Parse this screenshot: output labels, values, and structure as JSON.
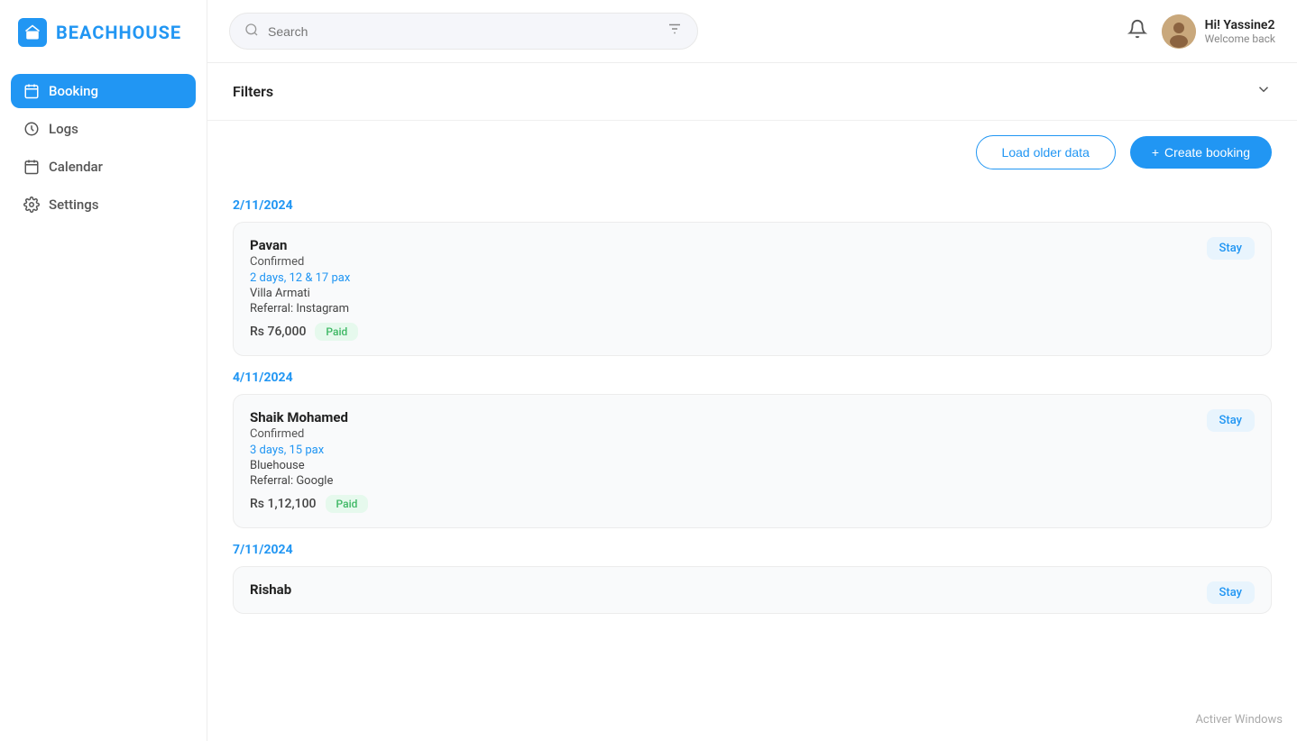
{
  "app": {
    "logo_text": "BEACHHOUSE",
    "logo_icon": "🏠"
  },
  "sidebar": {
    "items": [
      {
        "id": "booking",
        "label": "Booking",
        "icon": "📅",
        "active": true
      },
      {
        "id": "logs",
        "label": "Logs",
        "icon": "🕐",
        "active": false
      },
      {
        "id": "calendar",
        "label": "Calendar",
        "icon": "📆",
        "active": false
      },
      {
        "id": "settings",
        "label": "Settings",
        "icon": "⚙️",
        "active": false
      }
    ]
  },
  "topbar": {
    "search_placeholder": "Search",
    "user_name": "Hi! Yassine2",
    "user_welcome": "Welcome back"
  },
  "filters": {
    "title": "Filters"
  },
  "actions": {
    "load_older_label": "Load older data",
    "create_booking_label": "Create booking",
    "create_prefix": "+"
  },
  "bookings": [
    {
      "date": "2/11/2024",
      "entries": [
        {
          "name": "Pavan",
          "status": "Confirmed",
          "duration": "2 days, 12 & 17 pax",
          "venue": "Villa Armati",
          "referral": "Referral: Instagram",
          "amount": "Rs 76,000",
          "payment_status": "Paid",
          "type": "Stay"
        }
      ]
    },
    {
      "date": "4/11/2024",
      "entries": [
        {
          "name": "Shaik Mohamed",
          "status": "Confirmed",
          "duration": "3 days, 15 pax",
          "venue": "Bluehouse",
          "referral": "Referral: Google",
          "amount": "Rs 1,12,100",
          "payment_status": "Paid",
          "type": "Stay"
        }
      ]
    },
    {
      "date": "7/11/2024",
      "entries": [
        {
          "name": "Rishab",
          "status": "",
          "duration": "",
          "venue": "",
          "referral": "",
          "amount": "",
          "payment_status": "",
          "type": "Stay"
        }
      ]
    }
  ],
  "watermark": "Activer Windows"
}
